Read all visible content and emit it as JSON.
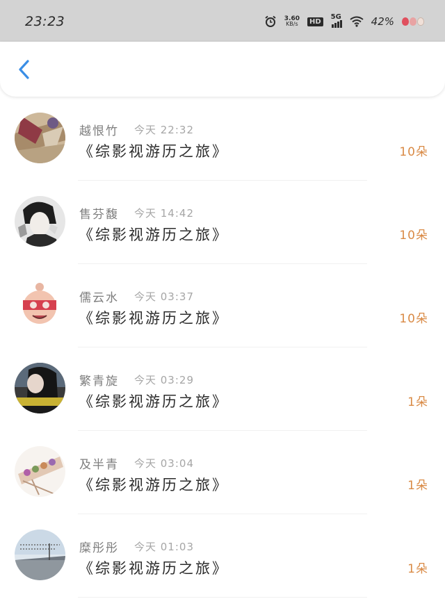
{
  "status_bar": {
    "time": "23:23",
    "net_speed_value": "3.60",
    "net_speed_unit": "KB/s",
    "hd_label": "HD",
    "network_label": "5G",
    "battery": "42%",
    "icons": [
      "alarm-icon",
      "hd-icon",
      "signal-icon",
      "wifi-icon",
      "strawberry-battery-icon"
    ]
  },
  "header": {
    "back_icon": "chevron-left-icon",
    "accent_color": "#3a8ee6"
  },
  "amount_color": "#d98a45",
  "rows": [
    {
      "name": "越恨竹",
      "time": "今天 22:32",
      "title": "《综影视游历之旅》",
      "amount": "10朵"
    },
    {
      "name": "售芬馥",
      "time": "今天 14:42",
      "title": "《综影视游历之旅》",
      "amount": "10朵"
    },
    {
      "name": "儒云水",
      "time": "今天 03:37",
      "title": "《综影视游历之旅》",
      "amount": "10朵"
    },
    {
      "name": "繁青旋",
      "time": "今天 03:29",
      "title": "《综影视游历之旅》",
      "amount": "1朵"
    },
    {
      "name": "及半青",
      "time": "今天 03:04",
      "title": "《综影视游历之旅》",
      "amount": "1朵"
    },
    {
      "name": "糜彤彤",
      "time": "今天 01:03",
      "title": "《综影视游历之旅》",
      "amount": "1朵"
    }
  ]
}
